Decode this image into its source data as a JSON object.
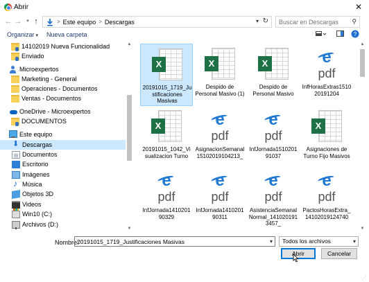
{
  "window": {
    "title": "Abrir",
    "close_label": "✕"
  },
  "nav": {
    "back": "←",
    "forward": "→",
    "up": "↑"
  },
  "address": {
    "crumbs": [
      "Este equipo",
      "Descargas"
    ],
    "separator": ">",
    "search_placeholder": "Buscar en Descargas"
  },
  "toolbar": {
    "organize_label": "Organizar",
    "new_folder_label": "Nueva carpeta"
  },
  "sidebar": {
    "items": [
      {
        "label": "14102019 Nueva Funcionalidad",
        "icon": "folder-user-icon"
      },
      {
        "label": "Enviado",
        "icon": "folder-user-icon"
      },
      {
        "label": "Microexpertos",
        "icon": "user-icon"
      },
      {
        "label": "Marketing - General",
        "icon": "folder-icon"
      },
      {
        "label": "Operaciones - Documentos",
        "icon": "folder-icon"
      },
      {
        "label": "Ventas - Documentos",
        "icon": "folder-icon"
      },
      {
        "label": "OneDrive - Microexpertos",
        "icon": "cloud-icon"
      },
      {
        "label": "DOCUMENTOS",
        "icon": "folder-user-icon"
      },
      {
        "label": "Este equipo",
        "icon": "computer-icon"
      },
      {
        "label": "Descargas",
        "icon": "download-icon",
        "selected": true
      },
      {
        "label": "Documentos",
        "icon": "documents-icon"
      },
      {
        "label": "Escritorio",
        "icon": "desktop-icon"
      },
      {
        "label": "Imágenes",
        "icon": "images-icon"
      },
      {
        "label": "Música",
        "icon": "music-icon"
      },
      {
        "label": "Objetos 3D",
        "icon": "objects-3d-icon"
      },
      {
        "label": "Videos",
        "icon": "videos-icon"
      },
      {
        "label": "Win10 (C:)",
        "icon": "drive-icon"
      },
      {
        "label": "Archivos (D:)",
        "icon": "network-drive-icon"
      }
    ]
  },
  "files": [
    {
      "name": "20191015_1719_Justificaciones Masivas",
      "type": "excel",
      "selected": true
    },
    {
      "name": "Despido de Personal Masivo (1)",
      "type": "excel"
    },
    {
      "name": "Despido de Personal Masivo",
      "type": "excel"
    },
    {
      "name": "InfHorasExtras151020191204",
      "type": "pdf"
    },
    {
      "name": "20191015_1042_Visualizacion Turno",
      "type": "excel"
    },
    {
      "name": "AsignacionSemanal15102019104213_",
      "type": "pdf"
    },
    {
      "name": "InfJornada151020191037",
      "type": "pdf"
    },
    {
      "name": "Asignaciones de Turno Fijo Masivos",
      "type": "excel"
    },
    {
      "name": "InfJornada141020190329",
      "type": "pdf"
    },
    {
      "name": "InfJornada141020190311",
      "type": "pdf"
    },
    {
      "name": "AsistenciaSemanalNormal_1410201913457_",
      "type": "pdf"
    },
    {
      "name": "PactosHorasExtra_14102019124740",
      "type": "pdf"
    }
  ],
  "icon_text": {
    "excel": "X",
    "pdf_e": "e",
    "pdf": "pdf"
  },
  "footer": {
    "name_label": "Nombre:",
    "name_value": "20191015_1719_Justificaciones Masivas",
    "filetype": "Todos los archivos",
    "open_label": "Abrir",
    "cancel_label": "Cancelar"
  },
  "colors": {
    "selection": "#cce8ff",
    "excel_green": "#1e7145",
    "pdf_blue": "#1f78d1",
    "link_blue": "#1e3a6e"
  }
}
